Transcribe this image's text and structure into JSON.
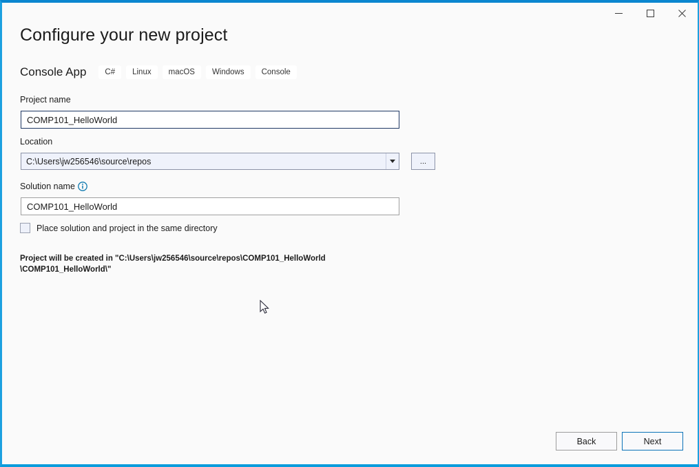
{
  "window": {
    "accent_color": "#0a9cdc",
    "background_color": "#fafafa",
    "controls": {
      "minimize_label": "Minimize",
      "maximize_label": "Maximize",
      "close_label": "Close"
    }
  },
  "header": {
    "title": "Configure your new project",
    "template_name": "Console App",
    "tags": [
      "C#",
      "Linux",
      "macOS",
      "Windows",
      "Console"
    ]
  },
  "form": {
    "project_name": {
      "label": "Project name",
      "value": "COMP101_HelloWorld",
      "focused": true
    },
    "location": {
      "label": "Location",
      "value": "C:\\Users\\jw256546\\source\\repos",
      "browse_label": "..."
    },
    "solution_name": {
      "label": "Solution name",
      "value": "COMP101_HelloWorld",
      "info_icon": "info-icon"
    },
    "same_directory": {
      "label": "Place solution and project in the same directory",
      "checked": false
    },
    "path_note": "Project will be created in \"C:\\Users\\jw256546\\source\\repos\\COMP101_HelloWorld\n\\COMP101_HelloWorld\\\""
  },
  "footer": {
    "back_label": "Back",
    "next_label": "Next",
    "next_accent_color": "#0a72b8"
  }
}
